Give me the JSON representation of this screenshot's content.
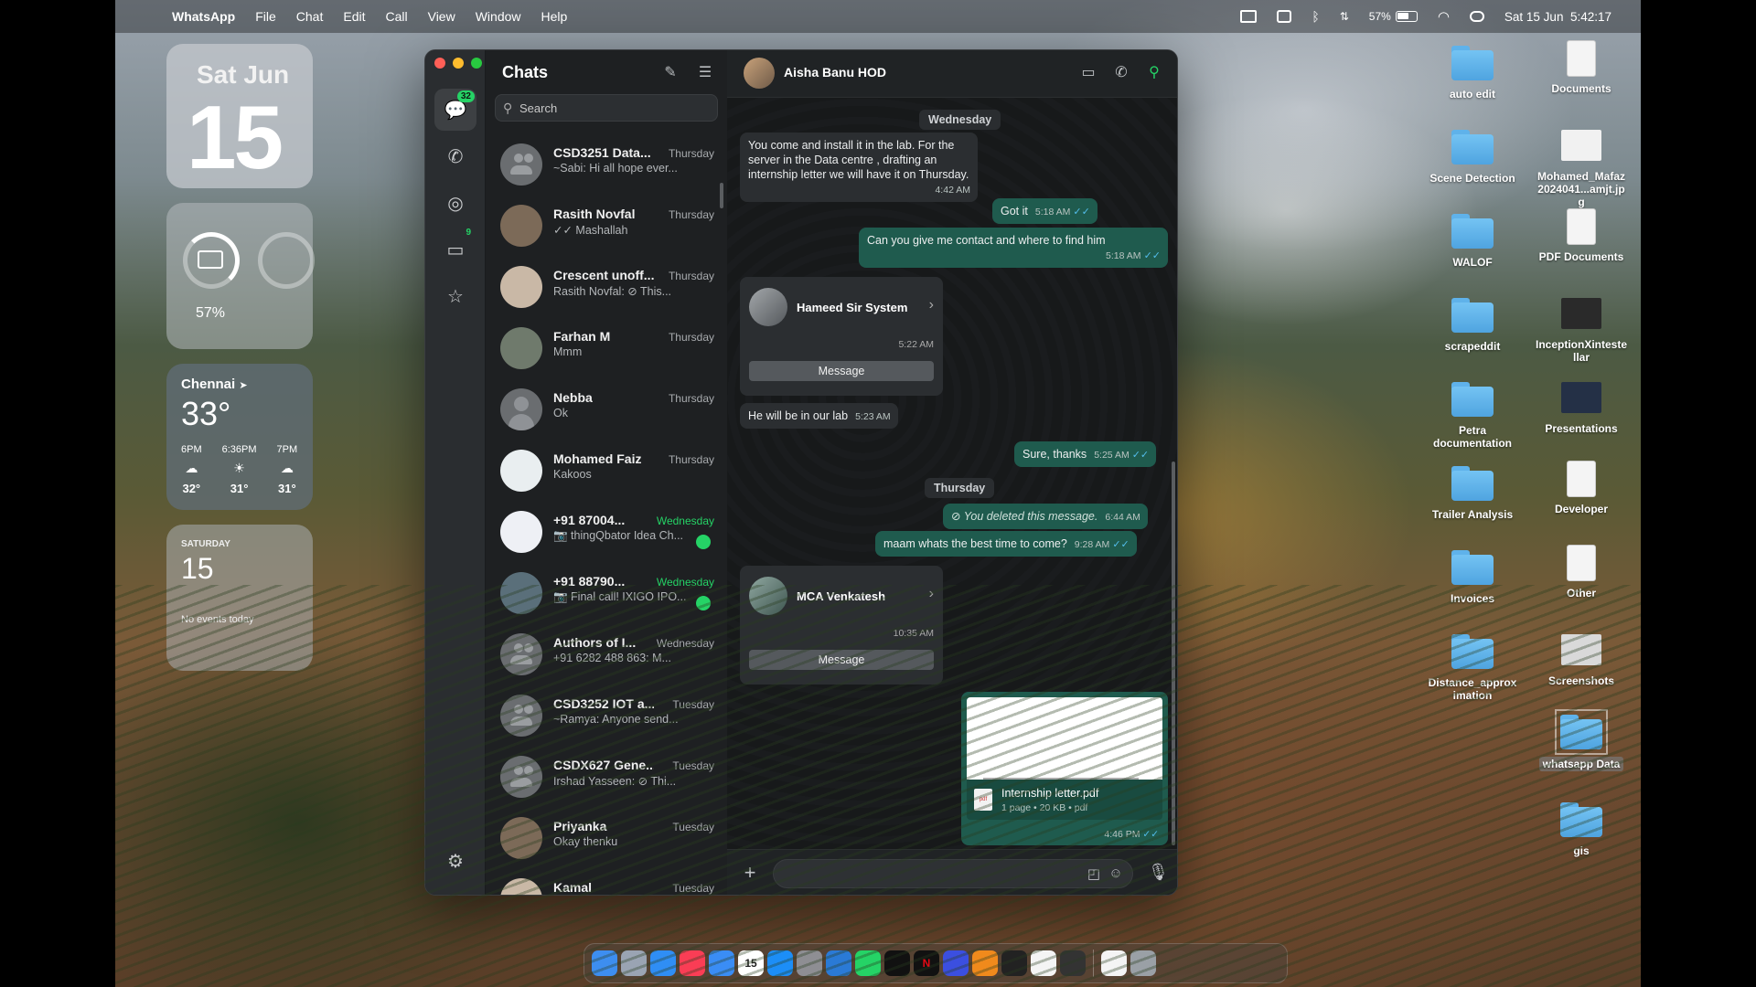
{
  "menubar": {
    "app": "WhatsApp",
    "items": [
      "File",
      "Chat",
      "Edit",
      "Call",
      "View",
      "Window",
      "Help"
    ],
    "battery": "57%",
    "clock": "Sat 15 Jun  5:42:17"
  },
  "widgets": {
    "date": {
      "dow": "Sat Jun",
      "day": "15"
    },
    "battery": {
      "percent": "57%"
    },
    "weather": {
      "city": "Chennai",
      "temp": "33°",
      "hours": [
        {
          "label": "6PM",
          "icon": "cloud-icon",
          "temp": "32°"
        },
        {
          "label": "6:36PM",
          "icon": "sunset-icon",
          "temp": "31°"
        },
        {
          "label": "7PM",
          "icon": "cloud-icon",
          "temp": "31°"
        }
      ]
    },
    "calendar": {
      "day": "SATURDAY",
      "num": "15",
      "events": "No events today"
    }
  },
  "desktop": {
    "icons": [
      {
        "label": "auto edit",
        "kind": "folder"
      },
      {
        "label": "Documents",
        "kind": "doc"
      },
      {
        "label": "Scene Detection",
        "kind": "folder"
      },
      {
        "label": "Mohamed_Mafaz2024041...amjt.jpg",
        "kind": "thumb"
      },
      {
        "label": "WALOF",
        "kind": "folder"
      },
      {
        "label": "PDF Documents",
        "kind": "doc"
      },
      {
        "label": "scrapeddit",
        "kind": "folder"
      },
      {
        "label": "InceptionXintestellar",
        "kind": "thumb"
      },
      {
        "label": "Petra documentation",
        "kind": "folder"
      },
      {
        "label": "Presentations",
        "kind": "thumb"
      },
      {
        "label": "Trailer Analysis",
        "kind": "folder"
      },
      {
        "label": "Developer",
        "kind": "doc"
      },
      {
        "label": "Invoices",
        "kind": "folder"
      },
      {
        "label": "Other",
        "kind": "doc"
      },
      {
        "label": "Distance_approximation",
        "kind": "folder"
      },
      {
        "label": "Screenshots",
        "kind": "thumb"
      },
      {
        "label": "whatsapp Data",
        "kind": "folder"
      },
      {
        "label": "gis",
        "kind": "folder"
      }
    ]
  },
  "whatsapp": {
    "rail": {
      "chats_badge": "32",
      "status_badge": "9"
    },
    "list": {
      "title": "Chats",
      "search_placeholder": "Search",
      "chats": [
        {
          "name": "CSD3251 Data...",
          "when": "Thursday",
          "preview": "~Sabi: Hi all hope ever...",
          "avatar": "group"
        },
        {
          "name": "Rasith Novfal",
          "when": "Thursday",
          "preview": "✓✓ Mashallah",
          "avatar": "photo"
        },
        {
          "name": "Crescent unoff...",
          "when": "Thursday",
          "preview": "Rasith Novfal: ⊘ This...",
          "avatar": "photo"
        },
        {
          "name": "Farhan M",
          "when": "Thursday",
          "preview": "Mmm",
          "avatar": "photo"
        },
        {
          "name": "Nebba",
          "when": "Thursday",
          "preview": "Ok",
          "avatar": "person"
        },
        {
          "name": "Mohamed Faiz",
          "when": "Thursday",
          "preview": "Kakoos",
          "avatar": "photo"
        },
        {
          "name": "+91 87004...",
          "when": "Wednesday",
          "preview": "📷 thingQbator Idea Ch...",
          "avatar": "photo",
          "unread": true
        },
        {
          "name": "+91 88790...",
          "when": "Wednesday",
          "preview": "📷 Final call! IXIGO IPO...",
          "avatar": "photo",
          "unread": true
        },
        {
          "name": "Authors of I...",
          "when": "Wednesday",
          "preview": "+91 6282 488 863: M...",
          "avatar": "group"
        },
        {
          "name": "CSD3252 IOT a...",
          "when": "Tuesday",
          "preview": "~Ramya: Anyone send...",
          "avatar": "group"
        },
        {
          "name": "CSDX627 Gene...",
          "when": "Tuesday",
          "preview": "Irshad Yasseen: ⊘ Thi...",
          "avatar": "group"
        },
        {
          "name": "Priyanka",
          "when": "Tuesday",
          "preview": "Okay thenku",
          "avatar": "photo"
        },
        {
          "name": "Kamal",
          "when": "Tuesday",
          "preview": "",
          "avatar": "photo"
        }
      ]
    },
    "conversation": {
      "contact": "Aisha Banu HOD",
      "sep_wed": "Wednesday",
      "sep_thu": "Thursday",
      "m1": {
        "text": "You come and install it in the lab. For the server in the Data centre , drafting an internship letter we will have it on Thursday.",
        "time": "4:42 AM"
      },
      "m2": {
        "text": "Got it",
        "time": "5:18 AM"
      },
      "m3": {
        "text": "Can you give me contact and where to find him",
        "time": "5:18 AM"
      },
      "card1": {
        "name": "Hameed Sir System",
        "time": "5:22 AM",
        "button": "Message"
      },
      "m4": {
        "text": "He will be in our lab",
        "time": "5:23 AM"
      },
      "m5": {
        "text": "Sure, thanks",
        "time": "5:25 AM"
      },
      "m6": {
        "text": "You deleted this message.",
        "time": "6:44 AM"
      },
      "m7": {
        "text": "maam whats the best time to come?",
        "time": "9:28 AM"
      },
      "card2": {
        "name": "MCA Venkatesh",
        "time": "10:35 AM",
        "button": "Message"
      },
      "pdf": {
        "name": "Internship letter.pdf",
        "meta": "1 page • 20 KB • pdf",
        "time": "4:46 PM",
        "icon_label": "pdf"
      },
      "composer_placeholder": ""
    }
  },
  "dock": {
    "apps": [
      "finder-icon",
      "launchpad-icon",
      "safari-icon",
      "music-icon",
      "mail-icon",
      "calendar-icon",
      "appstore-icon",
      "settings-icon",
      "vscode-icon",
      "whatsapp-icon",
      "appletv-icon",
      "netflix-icon",
      "prime-icon",
      "vlc-icon",
      "terminal-icon",
      "textedit-icon",
      "terminal2-icon",
      "file-icon",
      "trash-icon"
    ],
    "calendar_day": "15"
  }
}
